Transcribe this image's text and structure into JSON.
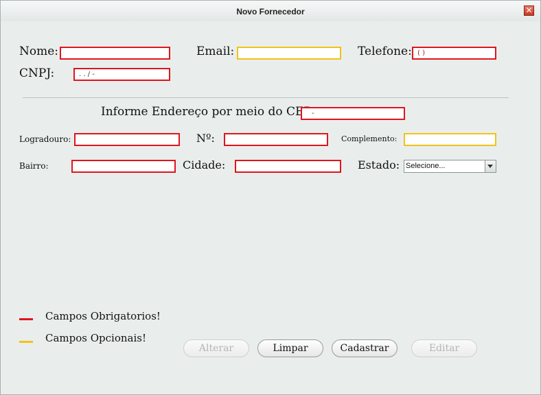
{
  "window": {
    "title": "Novo Fornecedor"
  },
  "form": {
    "nome_label": "Nome:",
    "email_label": "Email:",
    "telefone_label": "Telefone:",
    "telefone_value": "( )",
    "cnpj_label": "CNPJ:",
    "cnpj_value": ". . / -",
    "cep_label": "Informe Endereço por meio do CEP:",
    "cep_value": "-",
    "logradouro_label": "Logradouro:",
    "numero_label": "Nº:",
    "complemento_label": "Complemento:",
    "bairro_label": "Bairro:",
    "cidade_label": "Cidade:",
    "estado_label": "Estado:",
    "estado_selected": "Selecione..."
  },
  "legend": {
    "required": "Campos Obrigatorios!",
    "optional": "Campos Opcionais!",
    "required_color": "#e0141b",
    "optional_color": "#f2c215"
  },
  "buttons": {
    "alterar": "Alterar",
    "limpar": "Limpar",
    "cadastrar": "Cadastrar",
    "editar": "Editar"
  }
}
